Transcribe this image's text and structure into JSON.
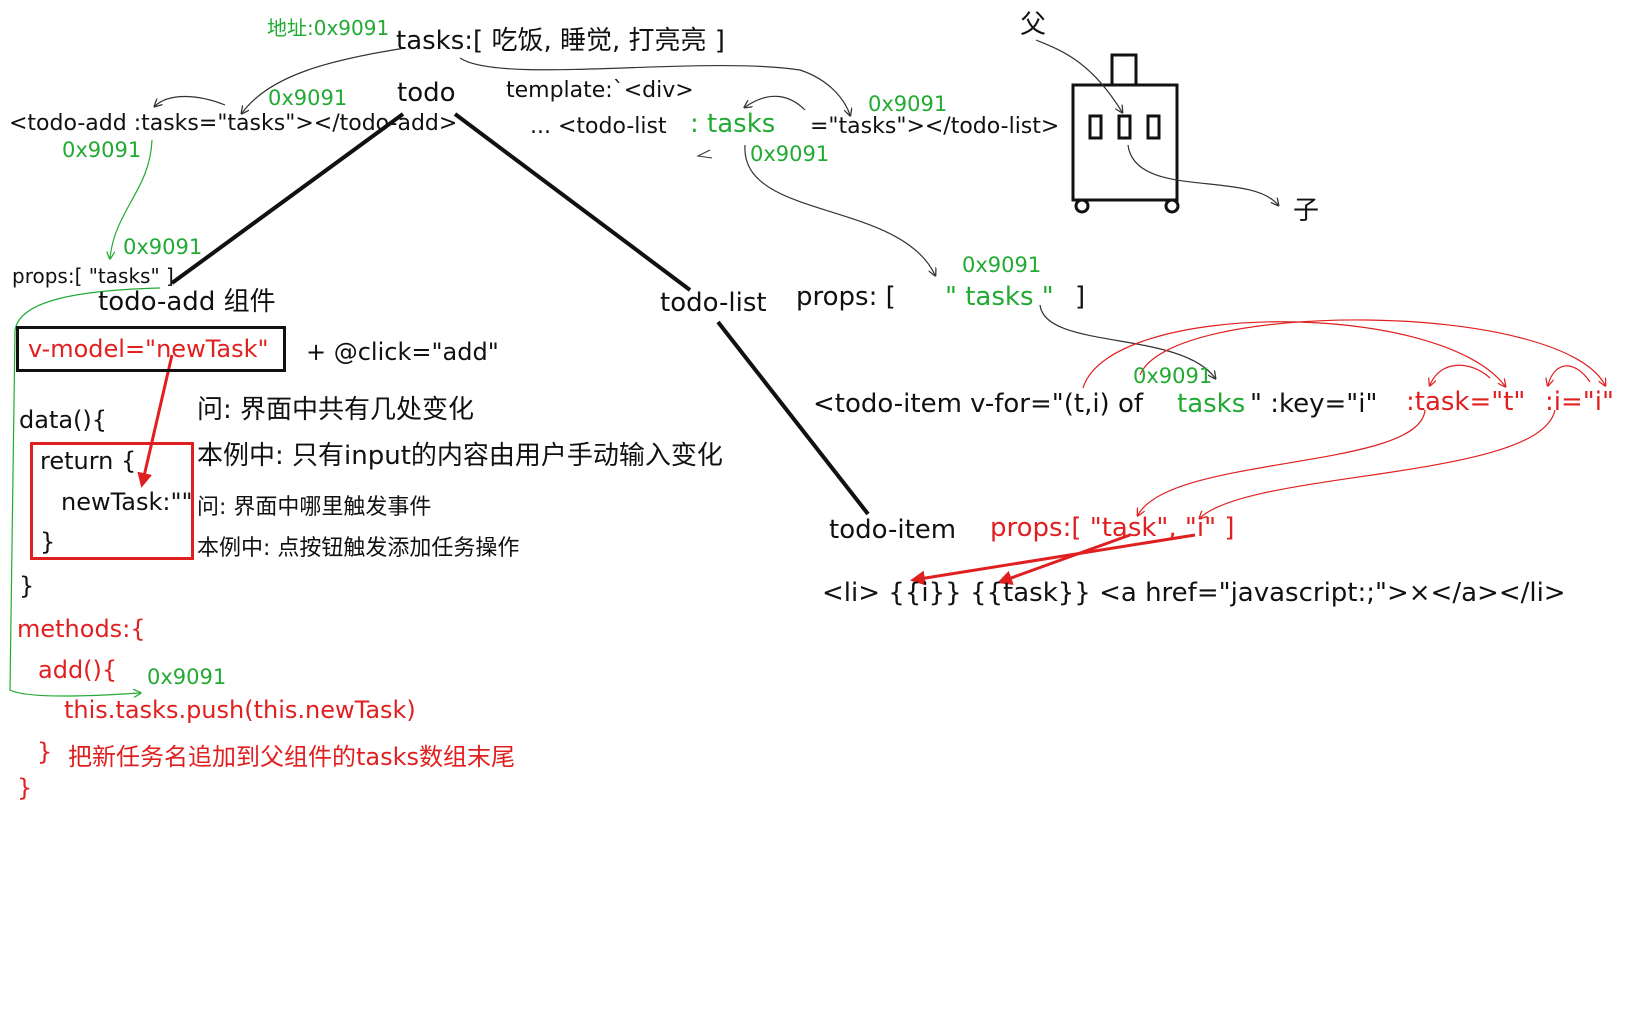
{
  "top": {
    "address_label": "地址:0x9091",
    "tasks_line": "tasks:[ 吃饭, 睡觉, 打亮亮 ]",
    "todo_label": "todo",
    "template_label": "template:`<div>",
    "todo_add_tag": "<todo-add :tasks=\"tasks\"></todo-add>",
    "todo_list_tag_left": "... <todo-list",
    "todo_list_tasks_binding": ": tasks",
    "todo_list_tag_right": "=\"tasks\"></todo-list>",
    "addr_near_add": "0x9091",
    "addr_below_add": "0x9091",
    "addr_right_top": "0x9091",
    "addr_right_below": "0x9091"
  },
  "suitcase": {
    "parent_label": "父",
    "child_label": "子"
  },
  "todo_add": {
    "addr": "0x9091",
    "props_line": "props:[ \"tasks\" ]",
    "title": "todo-add 组件",
    "vmodel": "v-model=\"newTask\"",
    "click": "+ @click=\"add\"",
    "data_open": "data(){",
    "return_open": "return {",
    "newtask_line": "newTask:\"\"",
    "return_close": "}",
    "data_close": "}",
    "methods_open": "methods:{",
    "add_open": "add(){",
    "push_addr": "0x9091",
    "push_line": "this.tasks.push(this.newTask)",
    "add_close": "}",
    "methods_close": "}",
    "note_append": "把新任务名追加到父组件的tasks数组末尾"
  },
  "questions": {
    "q1": "问: 界面中共有几处变化",
    "a1": "本例中: 只有input的内容由用户手动输入变化",
    "q2": "问: 界面中哪里触发事件",
    "a2": "本例中: 点按钮触发添加任务操作"
  },
  "todo_list": {
    "title": "todo-list",
    "props_label": "props: [",
    "props_value": "\" tasks \"",
    "props_close": "]",
    "props_addr": "0x9091",
    "vfor_addr": "0x9091",
    "vfor_left": "<todo-item v-for=\"(t,i) of",
    "vfor_tasks": "tasks",
    "vfor_key": "\" :key=\"i\"",
    "task_binding": ":task=\"t\"",
    "i_binding": ":i=\"i\""
  },
  "todo_item": {
    "title": "todo-item",
    "props": "props:[ \"task\", \"i\" ]",
    "li_line": "<li> {{i}} {{task}} <a href=\"javascript:;\">×</a></li>"
  },
  "colors": {
    "green": "#22aa33",
    "red": "#e02020",
    "black": "#111111"
  }
}
